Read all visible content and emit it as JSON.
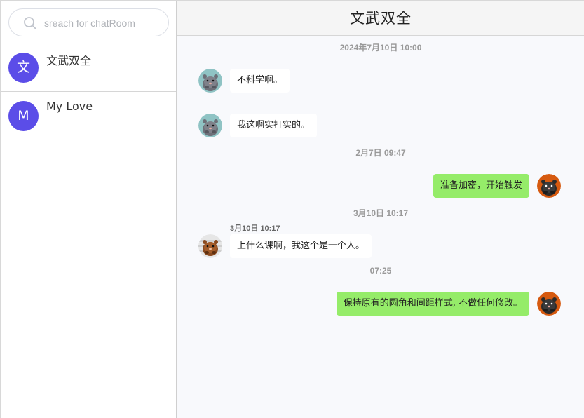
{
  "search": {
    "placeholder": "sreach for chatRoom",
    "value": ""
  },
  "rooms": [
    {
      "initial": "文",
      "name": "文武双全",
      "color": "#5b4de8"
    },
    {
      "initial": "M",
      "name": "My Love",
      "color": "#5b4de8"
    }
  ],
  "chat": {
    "title": "文武双全",
    "time_1": "2024年7月10日 10:00",
    "msg_1": "不科学啊。",
    "msg_2": "我这啊实打实的。",
    "time_2": "2月7日 09:47",
    "msg_3": "准备加密，开始触发",
    "time_3": "3月10日 10:17",
    "msg_4_time": "3月10日 10:17",
    "msg_4": "上什么课啊，我这个是一个人。",
    "time_4": "07:25",
    "msg_5": "保持原有的圆角和间距样式, 不做任何修改。"
  },
  "icons": {
    "search": "search-icon",
    "avatar_gray": "gray-hamster-avatar-icon",
    "avatar_orange": "orange-hamster-avatar-icon",
    "avatar_brown": "brown-hamster-avatar-icon"
  },
  "colors": {
    "room_avatar": "#5b4de8",
    "own_bubble": "#95ec69",
    "other_bubble": "#ffffff"
  }
}
